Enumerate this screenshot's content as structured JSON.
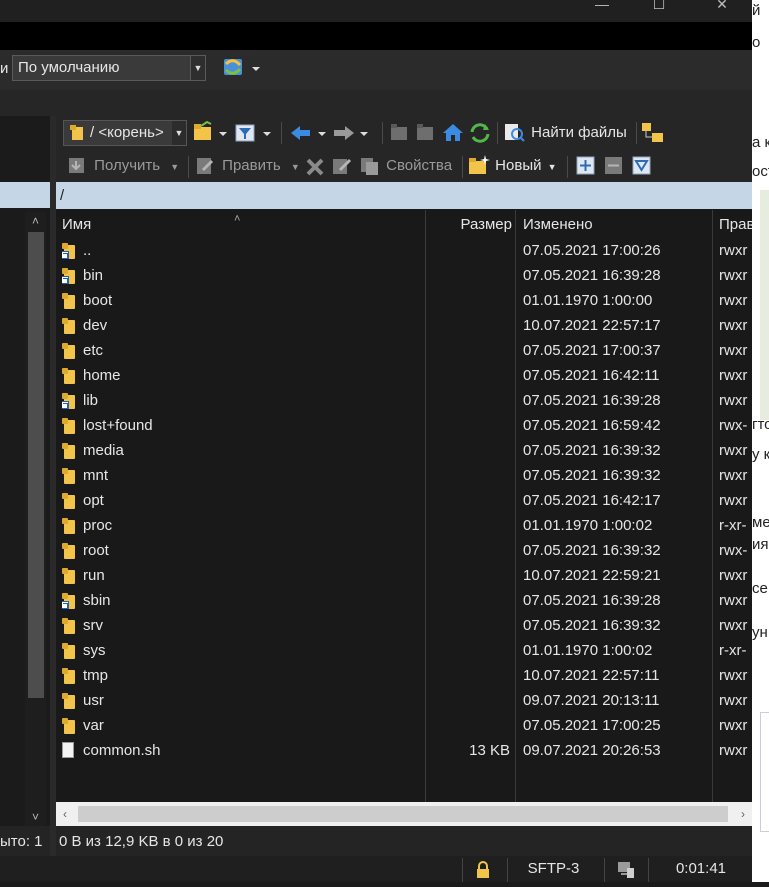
{
  "session": {
    "prefix": "и",
    "selected": "По умолчанию"
  },
  "window": {
    "minimize": "—",
    "maximize": "☐",
    "close": "✕"
  },
  "remote": {
    "path_combo": "/ <корень>",
    "path": "/",
    "toolbar": {
      "find_files": "Найти файлы",
      "download": "Получить",
      "edit": "Править",
      "properties": "Свойства",
      "new": "Новый"
    }
  },
  "columns": {
    "name": "Имя",
    "size": "Размер",
    "modified": "Изменено",
    "perms": "Прав"
  },
  "files": [
    {
      "name": "..",
      "size": "",
      "modified": "07.05.2021 17:00:26",
      "perms": "rwxr",
      "type": "parent"
    },
    {
      "name": "bin",
      "size": "",
      "modified": "07.05.2021 16:39:28",
      "perms": "rwxr",
      "type": "link"
    },
    {
      "name": "boot",
      "size": "",
      "modified": "01.01.1970 1:00:00",
      "perms": "rwxr",
      "type": "folder"
    },
    {
      "name": "dev",
      "size": "",
      "modified": "10.07.2021 22:57:17",
      "perms": "rwxr",
      "type": "folder"
    },
    {
      "name": "etc",
      "size": "",
      "modified": "07.05.2021 17:00:37",
      "perms": "rwxr",
      "type": "folder"
    },
    {
      "name": "home",
      "size": "",
      "modified": "07.05.2021 16:42:11",
      "perms": "rwxr",
      "type": "folder"
    },
    {
      "name": "lib",
      "size": "",
      "modified": "07.05.2021 16:39:28",
      "perms": "rwxr",
      "type": "link"
    },
    {
      "name": "lost+found",
      "size": "",
      "modified": "07.05.2021 16:59:42",
      "perms": "rwx-",
      "type": "folder"
    },
    {
      "name": "media",
      "size": "",
      "modified": "07.05.2021 16:39:32",
      "perms": "rwxr",
      "type": "folder"
    },
    {
      "name": "mnt",
      "size": "",
      "modified": "07.05.2021 16:39:32",
      "perms": "rwxr",
      "type": "folder"
    },
    {
      "name": "opt",
      "size": "",
      "modified": "07.05.2021 16:42:17",
      "perms": "rwxr",
      "type": "folder"
    },
    {
      "name": "proc",
      "size": "",
      "modified": "01.01.1970 1:00:02",
      "perms": "r-xr-",
      "type": "folder"
    },
    {
      "name": "root",
      "size": "",
      "modified": "07.05.2021 16:39:32",
      "perms": "rwx-",
      "type": "folder"
    },
    {
      "name": "run",
      "size": "",
      "modified": "10.07.2021 22:59:21",
      "perms": "rwxr",
      "type": "folder"
    },
    {
      "name": "sbin",
      "size": "",
      "modified": "07.05.2021 16:39:28",
      "perms": "rwxr",
      "type": "link"
    },
    {
      "name": "srv",
      "size": "",
      "modified": "07.05.2021 16:39:32",
      "perms": "rwxr",
      "type": "folder"
    },
    {
      "name": "sys",
      "size": "",
      "modified": "01.01.1970 1:00:02",
      "perms": "r-xr-",
      "type": "folder"
    },
    {
      "name": "tmp",
      "size": "",
      "modified": "10.07.2021 22:57:11",
      "perms": "rwxr",
      "type": "folder"
    },
    {
      "name": "usr",
      "size": "",
      "modified": "09.07.2021 20:13:11",
      "perms": "rwxr",
      "type": "folder"
    },
    {
      "name": "var",
      "size": "",
      "modified": "07.05.2021 17:00:25",
      "perms": "rwxr",
      "type": "folder"
    },
    {
      "name": "common.sh",
      "size": "13 KB",
      "modified": "09.07.2021 20:26:53",
      "perms": "rwxr",
      "type": "file"
    }
  ],
  "status": {
    "left": "ыто: 1",
    "right": "0 B из 12,9 KB в 0 из 20"
  },
  "bottom": {
    "protocol": "SFTP-3",
    "timer": "0:01:41"
  },
  "background_page": {
    "fragments": [
      "й",
      "о",
      "а к",
      "ост",
      "гто",
      "у к",
      "ме",
      "ия",
      "се",
      "ун"
    ]
  },
  "colors": {
    "accent_path": "#c5d6e6",
    "folder": "#f2c44a",
    "background": "#191919"
  }
}
